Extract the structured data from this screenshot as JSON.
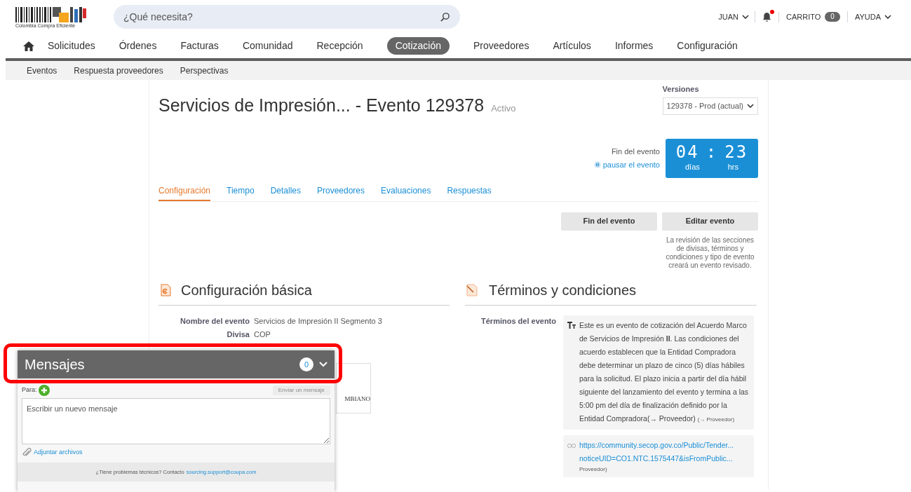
{
  "logo": {
    "caption": "Colombia Compra Eficiente"
  },
  "search": {
    "placeholder": "¿Qué necesita?"
  },
  "top_links": {
    "user": "JUAN",
    "notifications": {
      "unread": true
    },
    "cart": {
      "label": "CARRITO",
      "count": "0"
    },
    "help": "AYUDA"
  },
  "nav": [
    {
      "label": "Solicitudes",
      "selected": false
    },
    {
      "label": "Órdenes",
      "selected": false
    },
    {
      "label": "Facturas",
      "selected": false
    },
    {
      "label": "Comunidad",
      "selected": false
    },
    {
      "label": "Recepción",
      "selected": false
    },
    {
      "label": "Cotización",
      "selected": true
    },
    {
      "label": "Proveedores",
      "selected": false
    },
    {
      "label": "Artículos",
      "selected": false
    },
    {
      "label": "Informes",
      "selected": false
    },
    {
      "label": "Configuración",
      "selected": false
    }
  ],
  "subnav": [
    "Eventos",
    "Respuesta proveedores",
    "Perspectivas"
  ],
  "event": {
    "title": "Servicios de Impresión... - Evento 129378",
    "status": "Activo",
    "versions": {
      "label": "Versiones",
      "value": "129378 - Prod (actual)"
    },
    "end_label": "Fin del evento",
    "pause_link": "pausar el evento",
    "timer": {
      "days": "04",
      "separator": ":",
      "hours": "23",
      "days_label": "días",
      "hours_label": "hrs"
    },
    "tabs": [
      {
        "label": "Configuración",
        "selected": true
      },
      {
        "label": "Tiempo",
        "selected": false
      },
      {
        "label": "Detalles",
        "selected": false
      },
      {
        "label": "Proveedores",
        "selected": false
      },
      {
        "label": "Evaluaciones",
        "selected": false
      },
      {
        "label": "Respuestas",
        "selected": false
      }
    ],
    "buttons": [
      "Fin del evento",
      "Editar evento"
    ],
    "revision_note": "La revisión de las secciones de divisas, términos y condiciones y tipo de evento creará un evento revisado."
  },
  "basic_config": {
    "heading": "Configuración básica",
    "fields": [
      {
        "label": "Nombre del evento",
        "value": "Servicios de Impresión II Segmento 3"
      },
      {
        "label": "Divisa",
        "value": "COP"
      }
    ],
    "partial_logo_text": "MBIANO"
  },
  "terms": {
    "heading": "Términos y condiciones",
    "label": "Términos del evento",
    "text": "Este es un evento de cotización del Acuerdo Marco de Servicios de Impresión **II**. Las condiciones del acuerdo establecen que la Entidad Compradora debe determinar un plazo de cinco (5) días hábiles para la solicitud. El plazo inicia a partir del día hábil siguiente del lanzamiento del evento y termina a las 5:00 pm del día de finalización definido por la Entidad Compradora(→ Proveedor)",
    "text_note": "(→ Proveedor)",
    "link_lines": [
      "https://community.secop.gov.co/Public/Tender...",
      "noticeUID=CO1.NTC.1575447&isFromPublic..."
    ],
    "link_note": "Proveedor)"
  },
  "messages": {
    "title": "Mensajes",
    "count": "0",
    "to_label": "Para:",
    "send_button": {
      "label": "Enviar un mensaje",
      "disabled": true
    },
    "placeholder": "Escribir un nuevo mensaje",
    "attach": "Adjuntar archivos",
    "help_text": "¿Tiene problemas técnicos? Contacto",
    "help_link": "sourcing.support@coupa.com",
    "highlighted": true
  }
}
